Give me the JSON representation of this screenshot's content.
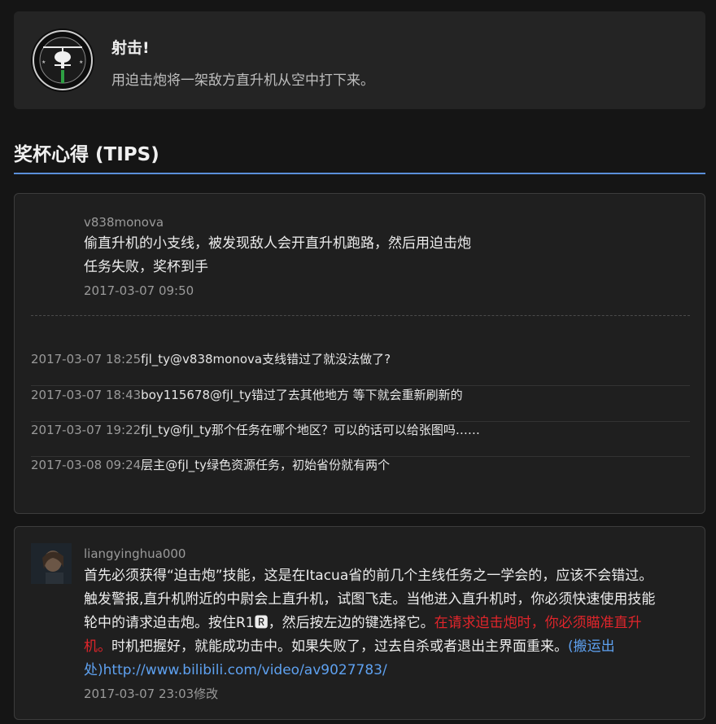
{
  "trophy": {
    "title": "射击!",
    "description": "用迫击炮将一架敌方直升机从空中打下来。",
    "icon": "helicopter-trophy-icon"
  },
  "section": {
    "title": "奖杯心得 (TIPS)"
  },
  "tips": [
    {
      "author": "v838monova",
      "lines": [
        "偷直升机的小支线，被发现敌人会开直升机跑路，然后用迫击炮",
        "任务失败，奖杯到手"
      ],
      "time": "2017-03-07 09:50",
      "replies": [
        {
          "time": "2017-03-07 18:25",
          "user": "fjl_ty",
          "text": "@v838monova支线错过了就没法做了?"
        },
        {
          "time": "2017-03-07 18:43",
          "user": "boy115678",
          "text": "@fjl_ty错过了去其他地方 等下就会重新刷新的"
        },
        {
          "time": "2017-03-07 19:22",
          "user": "fjl_ty",
          "text": "@fjl_ty那个任务在哪个地区？可以的话可以给张图吗……"
        },
        {
          "time": "2017-03-08 09:24",
          "user": "层主",
          "text": "@fjl_ty绿色资源任务，初始省份就有两个"
        }
      ]
    },
    {
      "author": "liangyinghua000",
      "line1": "首先必须获得“迫击炮”技能，这是在Itacua省的前几个主线任务之一学会的，应该不会错过。",
      "line2": "触发警报,直升机附近的中尉会上直升机，试图飞走。当他进入直升机时，你必须快速使用技能",
      "line3_normal": "轮中的请求迫击炮。按住R1🆁，然后按左边的键选择它。",
      "line3_red": "在请求迫击炮时，你必须瞄准直升",
      "line4_red": "机。",
      "line4_normal": "时机把握好，就能成功击中。如果失败了，过去自杀或者退出主界面重来。",
      "line4_link": "(搬运出",
      "line5_link": "处)",
      "url": "http://www.bilibili.com/video/av9027783/",
      "time": "2017-03-07 23:03修改",
      "colors": {
        "highlight": "#e0252b",
        "link": "#5ea1f0"
      }
    }
  ]
}
